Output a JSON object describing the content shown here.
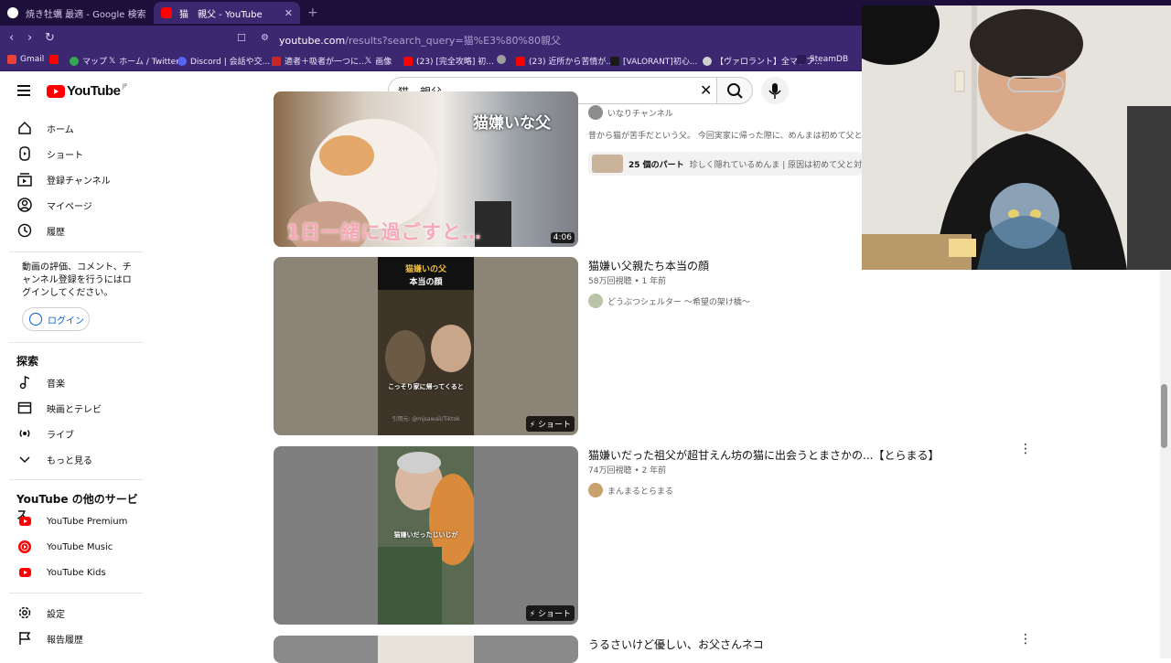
{
  "browser": {
    "tabs": [
      {
        "title": "焼き牡蠣 最適 - Google 検索",
        "active": false
      },
      {
        "title": "猫　親父 - YouTube",
        "active": true
      }
    ],
    "url_host": "youtube.com",
    "url_rest": "/results?search_query=猫%E3%80%80親父",
    "bookmarks": [
      "Gmail",
      "マップ",
      "ホーム / Twitter",
      "Discord | 会話や交...",
      "適者＋吸者が一つに...",
      "画像",
      "(23) [完全攻略] 初...",
      "(23) 近所から苦情が...",
      "[VALORANT]初心...",
      "【ヴァロラント】全マップ...",
      "SteamDB"
    ]
  },
  "masthead": {
    "logo_text": "YouTube",
    "logo_region": "JP",
    "search_query": "猫　親父"
  },
  "sidebar": {
    "items_main": [
      {
        "label": "ホーム",
        "icon": "home-icon"
      },
      {
        "label": "ショート",
        "icon": "shorts-icon"
      },
      {
        "label": "登録チャンネル",
        "icon": "subscriptions-icon"
      },
      {
        "label": "マイページ",
        "icon": "you-icon"
      },
      {
        "label": "履歴",
        "icon": "history-icon"
      }
    ],
    "login_message": "動画の評価、コメント、チャンネル登録を行うにはログインしてください。",
    "login_button": "ログイン",
    "explore_title": "探索",
    "items_explore": [
      {
        "label": "音楽",
        "icon": "music-icon"
      },
      {
        "label": "映画とテレビ",
        "icon": "movies-icon"
      },
      {
        "label": "ライブ",
        "icon": "live-icon"
      },
      {
        "label": "もっと見る",
        "icon": "chevron-down-icon"
      }
    ],
    "more_title": "YouTube の他のサービス",
    "items_more": [
      {
        "label": "YouTube Premium"
      },
      {
        "label": "YouTube Music"
      },
      {
        "label": "YouTube Kids"
      }
    ],
    "items_bottom": [
      {
        "label": "設定",
        "icon": "settings-icon"
      },
      {
        "label": "報告履歴",
        "icon": "flag-icon"
      }
    ]
  },
  "results": [
    {
      "channel": "いなりチャンネル",
      "description": "昔から猫が苦手だという父。 今回実家に帰った際に、めんまは初めて父と対面しま",
      "thumb_text_top": "猫嫌いな父",
      "thumb_text_bottom": "1日一緒に過ごすと…",
      "duration": "4:06",
      "chapters_label": "25 個のパート",
      "chapters_text": "珍しく隠れているめんま | 原因は初めて父と対面したか"
    },
    {
      "title": "猫嫌い父親たち本当の顔",
      "meta": "58万回視聴 • 1 年前",
      "channel": "どうぶつシェルター ～希望の架け橋～",
      "badge": "ショート",
      "thumb_text_top1": "猫嫌いの父",
      "thumb_text_top2": "本当の顔",
      "thumb_caption": "こっそり家に帰ってくると",
      "thumb_credit": "引用元: @mjsawali/Tiktok"
    },
    {
      "title": "猫嫌いだった祖父が超甘えん坊の猫に出会うとまさかの...【とらまる】",
      "meta": "74万回視聴 • 2 年前",
      "channel": "まんまるとらまる",
      "badge": "ショート",
      "thumb_caption": "猫嫌いだったじいじが"
    },
    {
      "title": "うるさいけど優しい、お父さんネコ"
    }
  ],
  "colors": {
    "yt_red": "#ff0000",
    "link_blue": "#065fd4",
    "browser_purple": "#3c2870"
  }
}
